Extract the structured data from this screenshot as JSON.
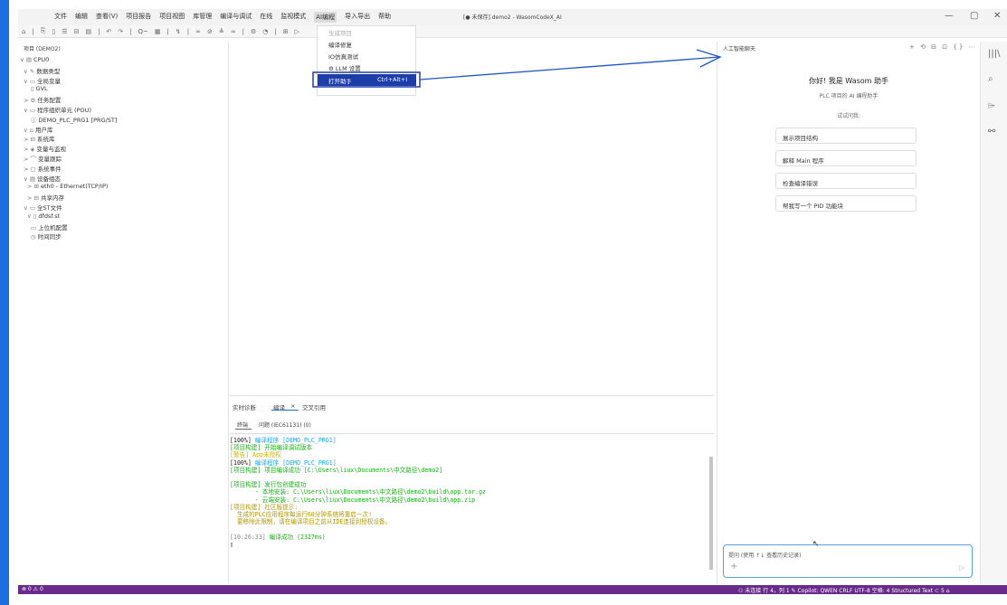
{
  "menu": [
    "文件",
    "编辑",
    "查看(V)",
    "项目报告",
    "项目视图",
    "库管理",
    "编译与调试",
    "在线",
    "监视模式",
    "AI编程",
    "导入导出",
    "帮助"
  ],
  "window_title": "[● 未保存] demo2 - WasomCodeX_AI",
  "window_controls": [
    "—",
    "▢",
    "✕"
  ],
  "toolbar_icons": [
    "⌂",
    "|",
    "⎘",
    "▯",
    "☰",
    "⊟",
    "▤",
    "|",
    "↶",
    "↷",
    "|",
    "Q~",
    "▦",
    "|",
    "↯",
    "|",
    "∞",
    "⊘",
    "≜",
    "≈",
    "|",
    "⚙",
    "◔",
    "|",
    "⊞",
    "▷"
  ],
  "tree": {
    "title": "项目 (DEMO2)",
    "items": [
      {
        "icon": "∨ ▤",
        "label": "CPU0"
      },
      {
        "icon": "∨ ✎",
        "label": "数据类型"
      },
      {
        "icon": "∨ ▭",
        "label": "全局变量"
      },
      {
        "icon": "▯",
        "label": "GVL"
      },
      {
        "icon": "> ⚙",
        "label": "任务配置"
      },
      {
        "icon": "∨ ▭",
        "label": "程序组织单元 (POU)"
      },
      {
        "icon": "ⓙ",
        "label": "DEMO_PLC_PRG1 [PRG/ST]"
      },
      {
        "icon": "∨ ⌂",
        "label": "用户库"
      },
      {
        "icon": "> ⊟",
        "label": "系统库"
      },
      {
        "icon": "> ◈",
        "label": "变量与监视"
      },
      {
        "icon": "> ⌒",
        "label": "变量跟踪"
      },
      {
        "icon": "> ▢",
        "label": "系统事件"
      },
      {
        "icon": "∨ ▤",
        "label": "设备组态"
      },
      {
        "icon": "> ⊞",
        "label": "eth0 - Ethernet(TCP/IP)"
      },
      {
        "icon": "> ⊟",
        "label": "共享内存"
      },
      {
        "icon": "∨ ▭",
        "label": "全ST文件"
      },
      {
        "icon": "∨ ▯",
        "label": "dfdsf.st"
      },
      {
        "icon": "▭",
        "label": "上位机配置"
      },
      {
        "icon": "◷",
        "label": "时间同步"
      }
    ]
  },
  "dropdown": {
    "items": [
      "生成项目",
      "编译修复",
      "IO仿真测试",
      "⚙ LLM 设置"
    ],
    "open_label": "打开助手",
    "open_shortcut": "Ctrl+Alt+I"
  },
  "panel": {
    "tabs": [
      "实时诊断",
      "编译",
      "交叉引用"
    ],
    "close_icon": "×",
    "subtabs": [
      "终端",
      "问题 (IEC61131) (0)"
    ],
    "console": [
      {
        "cls": "c-white",
        "prefix": "[100%] ",
        "text": "编译程序 [DEMO_PLC_PRG1]",
        "tcls": "c-blue"
      },
      {
        "cls": "c-green",
        "prefix": "",
        "text": "[项目构建] 开始编译调试版本",
        "tcls": "c-green"
      },
      {
        "cls": "c-yellow",
        "prefix": "",
        "text": "[警告] App未授权",
        "tcls": "c-yellow"
      },
      {
        "cls": "c-white",
        "prefix": "[100%] ",
        "text": "编译程序 [DEMO_PLC_PRG1]",
        "tcls": "c-blue"
      },
      {
        "cls": "c-green",
        "prefix": "",
        "text": "[项目构建] 项目编译成功 [C:\\Users\\liux\\Documents\\中文路径\\demo2]",
        "tcls": "c-green"
      },
      {
        "cls": "c-white",
        "prefix": "",
        "text": "",
        "tcls": "c-white"
      },
      {
        "cls": "c-green",
        "prefix": "",
        "text": "[项目构建] 发行包创建成功",
        "tcls": "c-green"
      },
      {
        "cls": "c-green",
        "prefix": "",
        "text": "       - 本地安装: C:\\Users\\liux\\Documents\\中文路径\\demo2\\build\\app.tar.gz",
        "tcls": "c-green"
      },
      {
        "cls": "c-green",
        "prefix": "",
        "text": "       - 云端安装: C:\\Users\\liux\\Documents\\中文路径\\demo2\\build\\app.zip",
        "tcls": "c-green"
      },
      {
        "cls": "c-gold",
        "prefix": "",
        "text": "[项目构建] 社区版提示:",
        "tcls": "c-gold"
      },
      {
        "cls": "c-gold",
        "prefix": "",
        "text": "  生成的PLC应用程序每运行60分钟系统将重启一次!",
        "tcls": "c-gold"
      },
      {
        "cls": "c-gold",
        "prefix": "",
        "text": "  要移除此限制，请在编译项目之前从IDE连接到授权设备。",
        "tcls": "c-gold"
      },
      {
        "cls": "c-white",
        "prefix": "",
        "text": "",
        "tcls": "c-white"
      },
      {
        "cls": "c-gray",
        "prefix": "[10:26:33] ",
        "text": "编译成功 (2327ms)",
        "tcls": "c-green"
      },
      {
        "cls": "c-white",
        "prefix": "",
        "text": "▯",
        "tcls": "c-white"
      }
    ]
  },
  "chat": {
    "title": "人工智能聊天",
    "actions": "+ ⟲ ⊟ ⊡ {} ⋯",
    "greeting": "你好! 我是 Wasom 助手",
    "subtitle": "PLC 项目的 AI 编程助手",
    "try_label": "试试问我:",
    "suggestions": [
      "展示项目结构",
      "解释 Main 程序",
      "检查编译错误",
      "帮我写一个 PID 功能块"
    ],
    "input_placeholder": "提问 (使用 ↑↓ 查看历史记录)",
    "plus_icon": "+",
    "send_icon": "▷"
  },
  "activity_icons": [
    "|||\\",
    "⌕",
    "⌲",
    "⚯"
  ],
  "status": {
    "left": "⊗ 0 ⚠ 0",
    "right": "⚇ 未连接   行 4，列 1   ✎ Copilot: QWEN   CRLF   UTF-8   空格: 4   Structured Text   ⊂ 5   ⌂"
  },
  "colors": {
    "accent_blue": "#1b6fe0",
    "status_purple": "#6a2a8c",
    "menu_highlight": "#1d3ea8"
  }
}
